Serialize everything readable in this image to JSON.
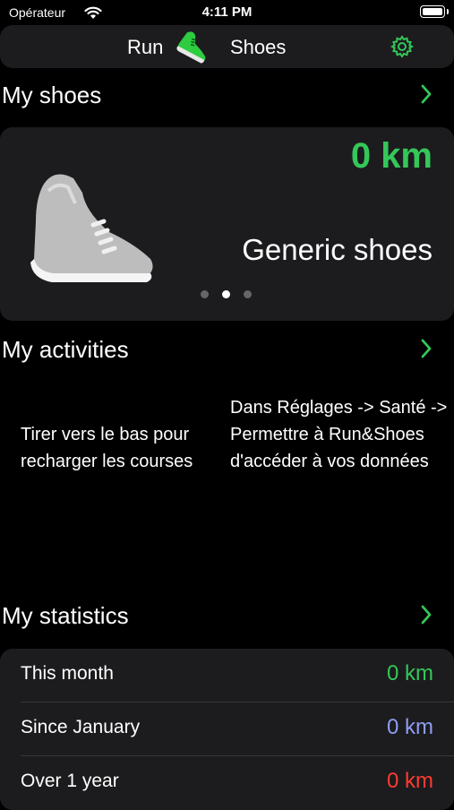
{
  "status_bar": {
    "carrier": "Opérateur",
    "time": "4:11 PM"
  },
  "nav": {
    "title_left": "Run",
    "title_right": "Shoes",
    "logo_icon": "running-shoe-icon",
    "settings_icon": "gear-icon"
  },
  "sections": {
    "shoes_title": "My shoes",
    "activities_title": "My activities",
    "statistics_title": "My statistics",
    "chevron": "›"
  },
  "shoe_card": {
    "distance": "0 km",
    "name": "Generic shoes",
    "page_count": 3,
    "active_page": 1
  },
  "activities": {
    "hint_left": "Tirer vers le bas pour recharger les courses",
    "hint_right": "Dans Réglages -> Santé -> Permettre à Run&Shoes d'accéder à vos données"
  },
  "statistics": {
    "rows": [
      {
        "label": "This month",
        "value": "0 km",
        "color": "#34c759"
      },
      {
        "label": "Since January",
        "value": "0 km",
        "color": "#8e9cf5"
      },
      {
        "label": "Over 1 year",
        "value": "0 km",
        "color": "#ff3b30"
      }
    ]
  },
  "colors": {
    "accent": "#34c759",
    "card_bg": "#1c1c1e"
  }
}
